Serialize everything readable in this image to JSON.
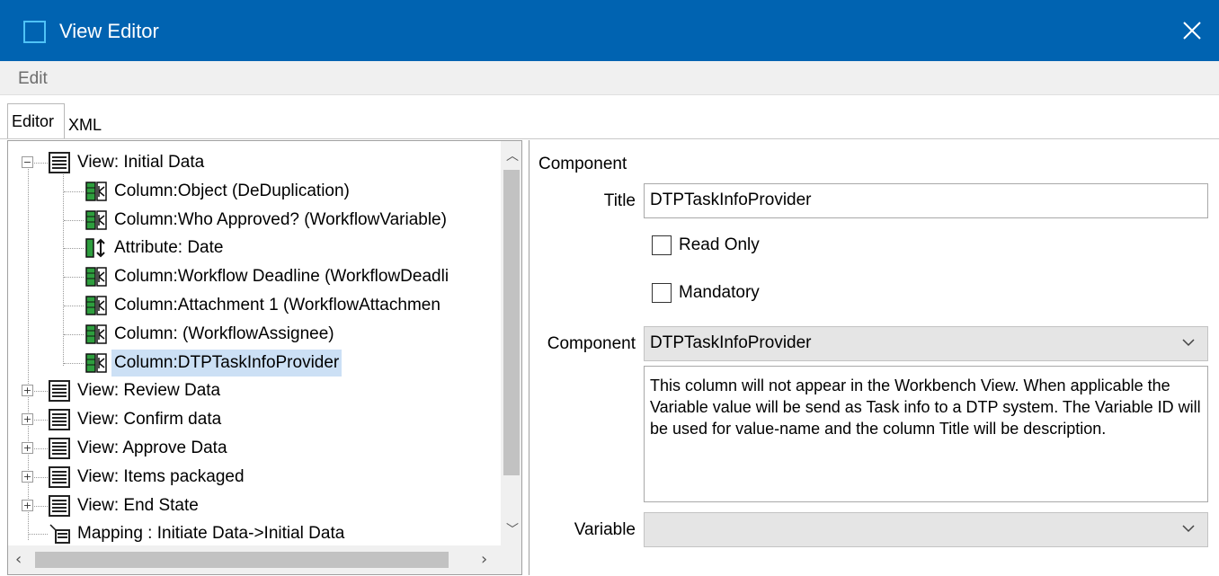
{
  "window": {
    "title": "View Editor"
  },
  "menu": {
    "items": [
      "Edit"
    ]
  },
  "tabs": {
    "editor": "Editor",
    "xml": "XML"
  },
  "tree": {
    "nodes": [
      {
        "label": "View: Initial Data",
        "type": "view",
        "expanded": true
      },
      {
        "label": "Column:Object (DeDuplication)",
        "type": "column"
      },
      {
        "label": "Column:Who Approved? (WorkflowVariable)",
        "type": "column"
      },
      {
        "label": "Attribute: Date",
        "type": "attribute"
      },
      {
        "label": "Column:Workflow Deadline (WorkflowDeadli",
        "type": "column"
      },
      {
        "label": "Column:Attachment 1 (WorkflowAttachmen",
        "type": "column"
      },
      {
        "label": "Column: (WorkflowAssignee)",
        "type": "column"
      },
      {
        "label": "Column:DTPTaskInfoProvider",
        "type": "column",
        "selected": true
      },
      {
        "label": "View: Review Data",
        "type": "view",
        "expanded": false
      },
      {
        "label": "View: Confirm data",
        "type": "view",
        "expanded": false
      },
      {
        "label": "View: Approve Data",
        "type": "view",
        "expanded": false
      },
      {
        "label": "View: Items packaged",
        "type": "view",
        "expanded": false
      },
      {
        "label": "View: End State",
        "type": "view",
        "expanded": false
      },
      {
        "label": "Mapping : Initiate Data->Initial Data",
        "type": "mapping"
      }
    ]
  },
  "component_panel": {
    "section_title": "Component",
    "title_label": "Title",
    "title_value": "DTPTaskInfoProvider",
    "read_only_label": "Read Only",
    "read_only_checked": false,
    "mandatory_label": "Mandatory",
    "mandatory_checked": false,
    "component_label": "Component",
    "component_value": "DTPTaskInfoProvider",
    "description": "This column will not appear in the Workbench View. When applicable the Variable value will be send as Task info to a DTP system. The Variable ID will be used for value-name and the column Title will be description.",
    "variable_label": "Variable",
    "variable_value": ""
  },
  "colors": {
    "titlebar": "#0063b1",
    "selection": "#cce0f5",
    "column_icon_green": "#2e9e3e"
  }
}
